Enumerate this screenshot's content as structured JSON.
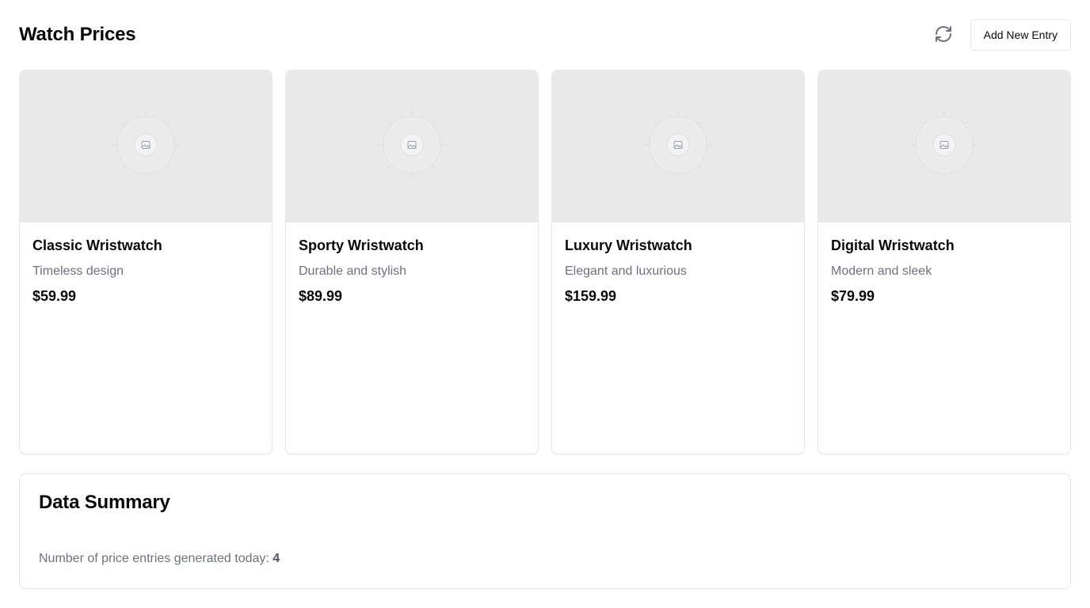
{
  "header": {
    "title": "Watch Prices",
    "refresh_icon": "refresh-icon",
    "add_button_label": "Add New Entry"
  },
  "products": [
    {
      "name": "Classic Wristwatch",
      "description": "Timeless design",
      "price": "$59.99",
      "image_icon": "image-placeholder-icon"
    },
    {
      "name": "Sporty Wristwatch",
      "description": "Durable and stylish",
      "price": "$89.99",
      "image_icon": "image-placeholder-icon"
    },
    {
      "name": "Luxury Wristwatch",
      "description": "Elegant and luxurious",
      "price": "$159.99",
      "image_icon": "image-placeholder-icon"
    },
    {
      "name": "Digital Wristwatch",
      "description": "Modern and sleek",
      "price": "$79.99",
      "image_icon": "image-placeholder-icon"
    }
  ],
  "summary": {
    "title": "Data Summary",
    "label": "Number of price entries generated today: ",
    "count": "4"
  },
  "colors": {
    "muted_text": "#6b7280",
    "border": "#e5e7eb",
    "image_placeholder_bg": "#e9e9e9"
  }
}
